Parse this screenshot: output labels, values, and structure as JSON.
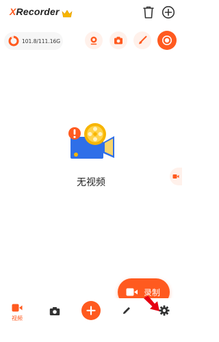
{
  "app": {
    "title_accent": "X",
    "title_rest": "Recorder"
  },
  "storage": {
    "text": "101.8/111.16G"
  },
  "empty_state": {
    "message": "无视频"
  },
  "record_button": {
    "label": "录制"
  },
  "bottom_nav": {
    "items": [
      {
        "label": "视频",
        "icon": "video-icon",
        "active": true
      },
      {
        "label": "",
        "icon": "camera-icon",
        "active": false
      },
      {
        "label": "",
        "icon": "plus-icon",
        "active": false
      },
      {
        "label": "",
        "icon": "pencil-icon",
        "active": false
      },
      {
        "label": "",
        "icon": "gear-icon",
        "active": false
      }
    ]
  },
  "colors": {
    "accent": "#ff5a1f",
    "accent_light": "#fff1eb",
    "illustration_blue": "#2f6fe8",
    "illustration_gold": "#f7b500"
  }
}
